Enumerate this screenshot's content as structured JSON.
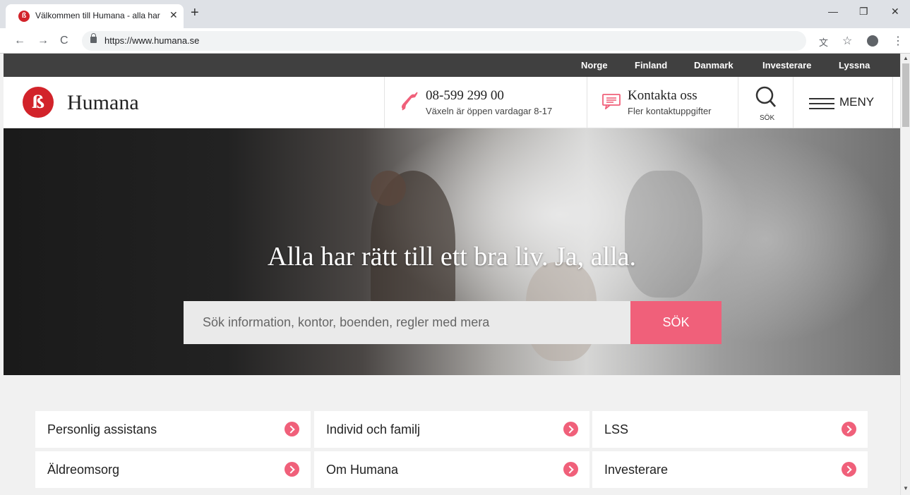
{
  "browser": {
    "tab_title": "Välkommen till Humana - alla har",
    "tab_close": "✕",
    "new_tab": "+",
    "url": "https://www.humana.se",
    "window_min": "—",
    "window_restore": "❐",
    "window_close": "✕",
    "back": "←",
    "forward": "→",
    "reload": "C",
    "translate": "文",
    "bookmark": "☆",
    "menu": "⋮"
  },
  "topnav": {
    "items": [
      "Norge",
      "Finland",
      "Danmark",
      "Investerare",
      "Lyssna"
    ]
  },
  "header": {
    "logo_text": "Humana",
    "phone_number": "08-599 299 00",
    "phone_note": "Växeln är öppen vardagar 8-17",
    "contact_title": "Kontakta oss",
    "contact_sub": "Fler kontaktuppgifter",
    "search_label": "SÖK",
    "menu_label": "MENY"
  },
  "hero": {
    "title": "Alla har rätt till ett bra liv. Ja, alla.",
    "search_placeholder": "Sök information, kontor, boenden, regler med mera",
    "search_button": "SÖK"
  },
  "categories": [
    "Personlig assistans",
    "Individ och familj",
    "LSS",
    "Äldreomsorg",
    "Om Humana",
    "Investerare"
  ],
  "colors": {
    "brand_red": "#d2232a",
    "accent_pink": "#f0607a",
    "topbar": "#404040"
  }
}
